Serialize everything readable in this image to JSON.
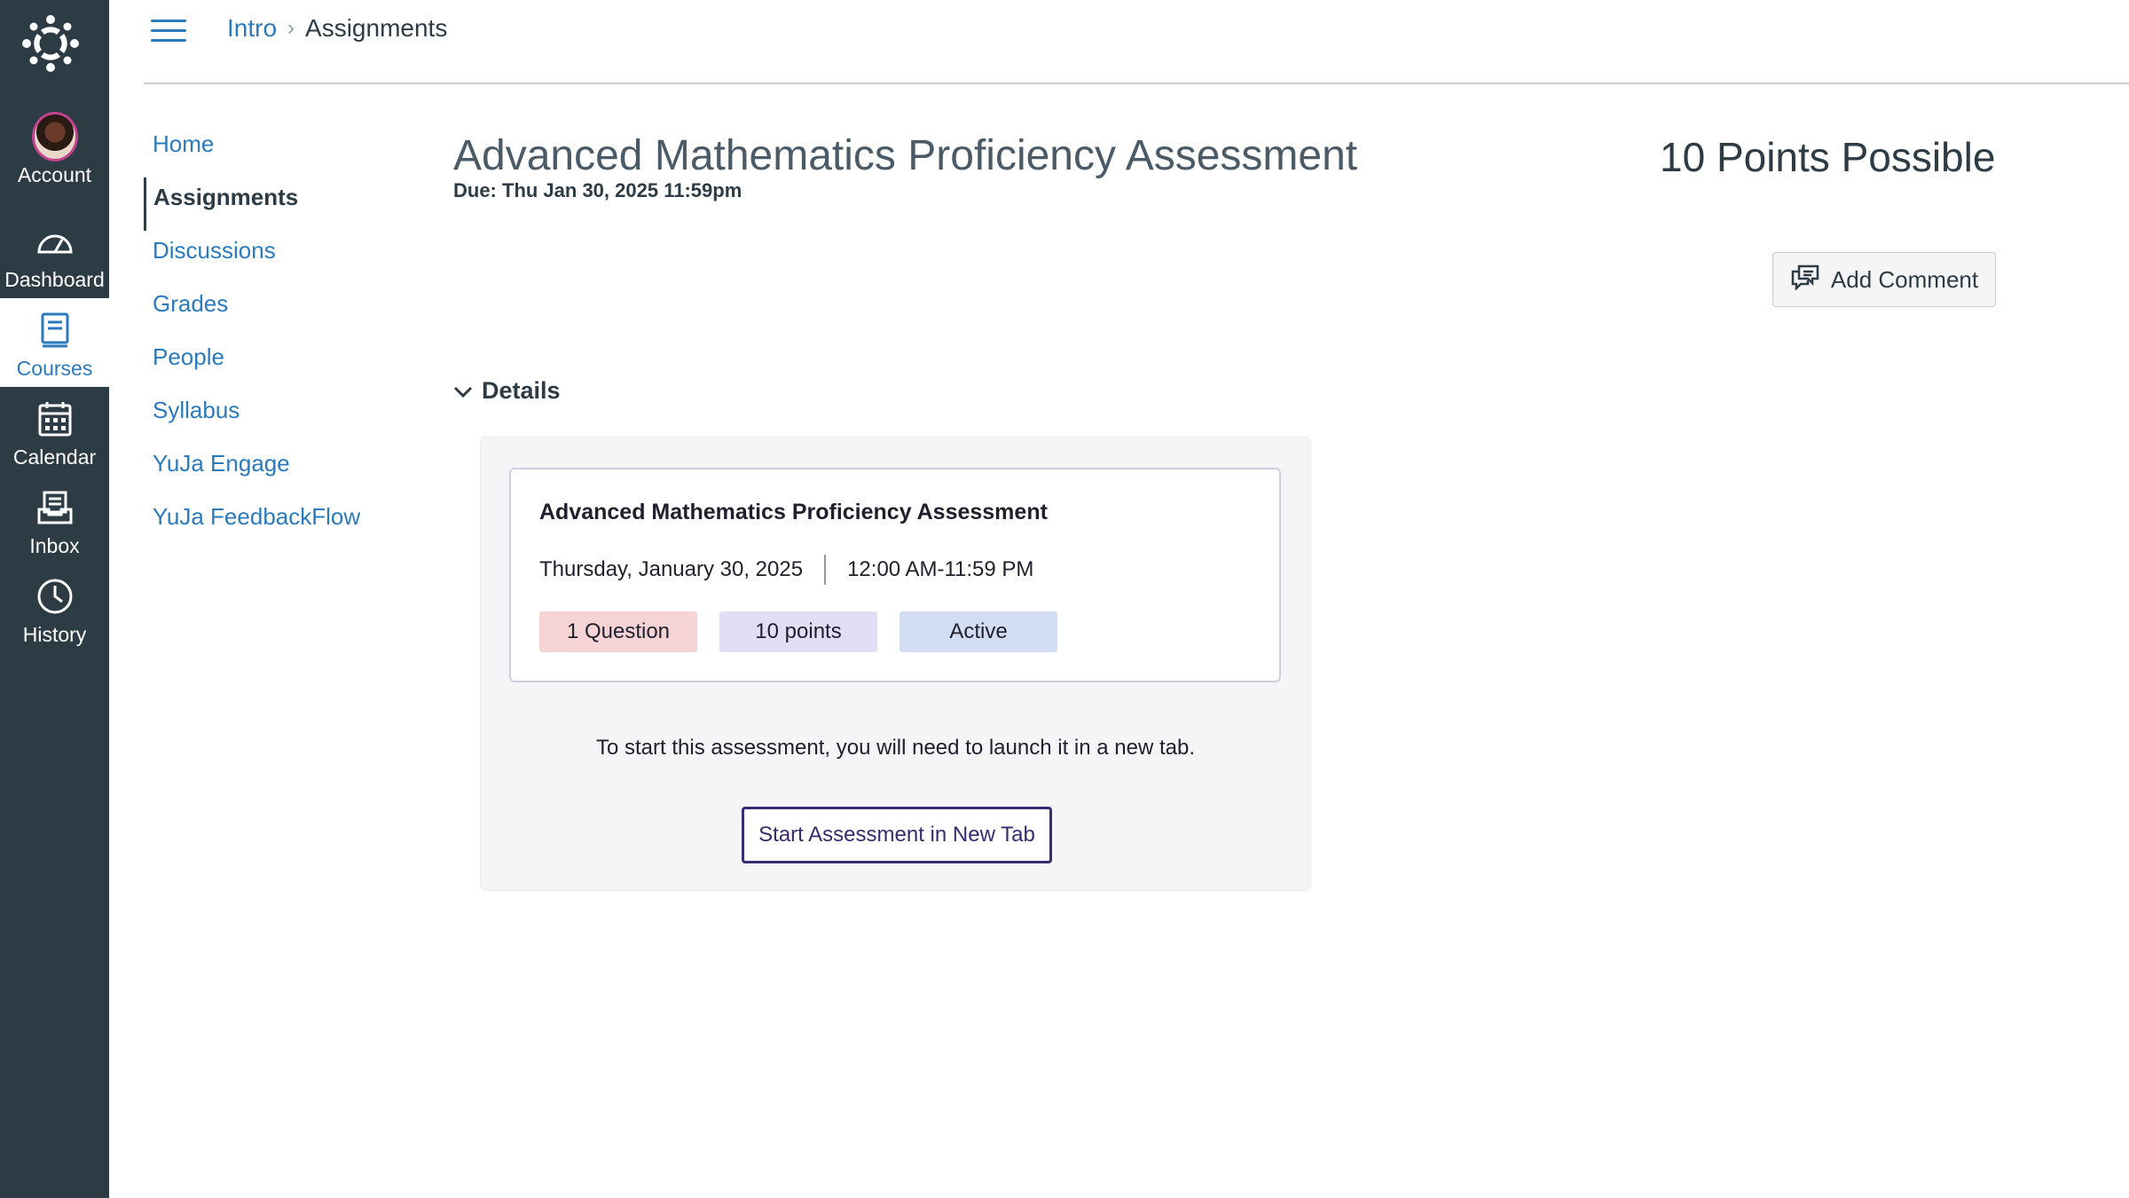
{
  "global_nav": {
    "items": [
      {
        "label": "Account",
        "icon": "avatar"
      },
      {
        "label": "Dashboard",
        "icon": "dashboard-icon"
      },
      {
        "label": "Courses",
        "icon": "courses-icon"
      },
      {
        "label": "Calendar",
        "icon": "calendar-icon"
      },
      {
        "label": "Inbox",
        "icon": "inbox-icon"
      },
      {
        "label": "History",
        "icon": "history-icon"
      }
    ],
    "active": "Courses",
    "colors": {
      "background": "#2d3b45",
      "active_text": "#2b7abc"
    }
  },
  "header": {
    "breadcrumb": {
      "course": "Intro",
      "separator": "›",
      "current": "Assignments"
    }
  },
  "course_nav": {
    "items": [
      {
        "label": "Home"
      },
      {
        "label": "Assignments"
      },
      {
        "label": "Discussions"
      },
      {
        "label": "Grades"
      },
      {
        "label": "People"
      },
      {
        "label": "Syllabus"
      },
      {
        "label": "YuJa Engage"
      },
      {
        "label": "YuJa FeedbackFlow"
      }
    ],
    "active": "Assignments"
  },
  "assignment": {
    "title": "Advanced Mathematics Proficiency Assessment",
    "due": "Due: Thu Jan 30, 2025 11:59pm",
    "points_possible": "10 Points Possible",
    "add_comment_label": "Add Comment",
    "details_label": "Details"
  },
  "yuja": {
    "card_title": "Advanced Mathematics Proficiency Assessment",
    "date": "Thursday, January 30, 2025",
    "time": "12:00 AM-11:59 PM",
    "badges": {
      "questions": "1 Question",
      "points": "10 points",
      "status": "Active"
    },
    "launch_text": "To start this assessment, you will need to launch it in a new tab.",
    "start_button": "Start Assessment in New Tab",
    "colors": {
      "button_border": "#3a2a6e",
      "badge_questions": "#f6d4d6",
      "badge_points": "#e2def5",
      "badge_status": "#d2dcf2"
    }
  }
}
